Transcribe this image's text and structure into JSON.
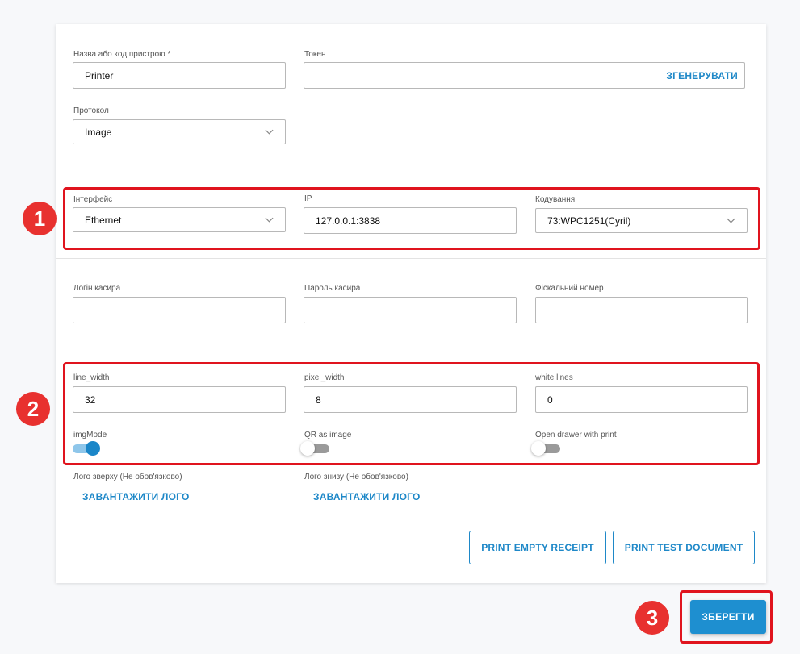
{
  "device": {
    "name_label": "Назва або код пристрою *",
    "name_value": "Printer",
    "token_label": "Токен",
    "token_value": "",
    "generate_label": "ЗГЕНЕРУВАТИ",
    "protocol_label": "Протокол",
    "protocol_value": "Image"
  },
  "connection": {
    "interface_label": "Інтерфейс",
    "interface_value": "Ethernet",
    "ip_label": "IP",
    "ip_value": "127.0.0.1:3838",
    "encoding_label": "Кодування",
    "encoding_value": "73:WPC1251(Cyril)"
  },
  "cashier": {
    "login_label": "Логін касира",
    "login_value": "",
    "password_label": "Пароль касира",
    "password_value": "",
    "fiscal_label": "Фіскальний номер",
    "fiscal_value": ""
  },
  "print_settings": {
    "line_width_label": "line_width",
    "line_width_value": "32",
    "pixel_width_label": "pixel_width",
    "pixel_width_value": "8",
    "white_lines_label": "white lines",
    "white_lines_value": "0",
    "img_mode_label": "imgMode",
    "img_mode_on": true,
    "qr_label": "QR as image",
    "qr_on": false,
    "drawer_label": "Open drawer with print",
    "drawer_on": false
  },
  "logo": {
    "top_label": "Лого зверху (Не обов'язково)",
    "top_button": "ЗАВАНТАЖИТИ ЛОГО",
    "bottom_label": "Лого знизу (Не обов'язково)",
    "bottom_button": "ЗАВАНТАЖИТИ ЛОГО"
  },
  "actions": {
    "print_empty": "PRINT EMPTY RECEIPT",
    "print_test": "PRINT TEST DOCUMENT",
    "save": "ЗБЕРЕГТИ"
  },
  "annotations": {
    "badge_1": "1",
    "badge_2": "2",
    "badge_3": "3"
  },
  "colors": {
    "accent": "#1e88c8",
    "highlight": "#e0141e",
    "badge": "#e8312f"
  }
}
